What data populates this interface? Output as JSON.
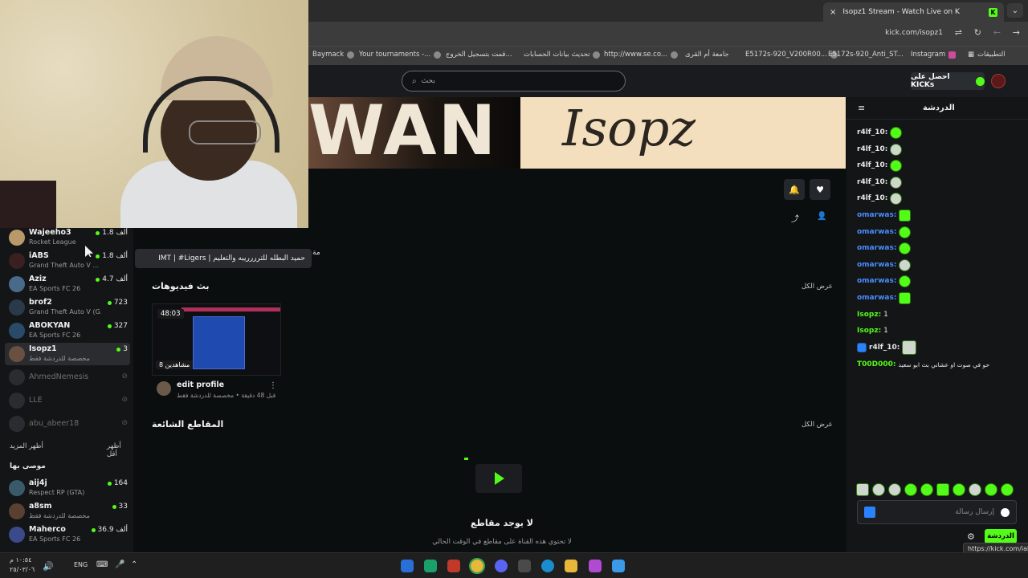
{
  "browser": {
    "tab_title": "Isopz1 Stream - Watch Live on K",
    "url": "kick.com/isopz1",
    "new_tab": "+",
    "close": "×",
    "bookmarks": [
      "Baymack",
      "Your tournaments -...",
      "قمت بتسجيل الخروج...",
      "تحديث بيانات الحسابات",
      "http://www.se.co...",
      "جامعة أم القرى",
      "E5172s-920_V200R00...",
      "E5172s-920_Anti_ST...",
      "Instagram",
      "التطبيقات"
    ]
  },
  "kick": {
    "search_placeholder": "بحث",
    "get_kicks": "احصل على KICKs"
  },
  "banner": {
    "left_text": "WAN",
    "right_text": "Isopz"
  },
  "sidebar": {
    "channels": [
      {
        "name": "Wajeeho3",
        "game": "Rocket League",
        "viewers": "1.8 ألف"
      },
      {
        "name": "iABS",
        "game": "Grand Theft Auto V ...",
        "viewers": "1.8 ألف"
      },
      {
        "name": "Aziz",
        "game": "EA Sports FC 26",
        "viewers": "4.7 ألف"
      },
      {
        "name": "brof2",
        "game": "Grand Theft Auto V (G...",
        "viewers": "723"
      },
      {
        "name": "ABOKYAN",
        "game": "EA Sports FC 26",
        "viewers": "327"
      },
      {
        "name": "Isopz1",
        "game": "مخصصة للدردشة فقط",
        "viewers": "3"
      }
    ],
    "offline": [
      "AhmedNemesis",
      "LLE",
      "abu_abeer18"
    ],
    "show_more": "أظهر المزيد",
    "show_less": "أظهر أقل",
    "recommended_title": "موصى بها",
    "recommended": [
      {
        "name": "aij4j",
        "game": "Respect RP (GTA)",
        "viewers": "164"
      },
      {
        "name": "a8sm",
        "game": "مخصصة للدردشة فقط",
        "viewers": "33"
      },
      {
        "name": "Maherco",
        "game": "EA Sports FC 26",
        "viewers": "36.9 ألف"
      }
    ]
  },
  "main": {
    "tooltip": "IMT | #Ligers | حميد البطله للترررريبه والتعليم",
    "past_videos_title": "بث فيديوهات",
    "show_all": "عرض الكل",
    "video": {
      "duration": "48:03",
      "views": "8 مشاهدين",
      "title": "edit profile",
      "sub": "قبل 48 دقيقة • مخصصة للدردشة فقط"
    },
    "clips_title": "المقاطع الشائعة",
    "clips_show_all": "عرض الكل",
    "empty_title": "لا يوجد مقاطع",
    "empty_sub": "لا تحتوي هذه القناة على مقاطع في الوقت الحالي",
    "cut_text": "مة"
  },
  "chat": {
    "title": "الدردشة",
    "messages": [
      {
        "user": "r4lf_10:",
        "color": "#e8e8e8",
        "text": ""
      },
      {
        "user": "r4lf_10:",
        "color": "#e8e8e8",
        "text": ""
      },
      {
        "user": "r4lf_10:",
        "color": "#e8e8e8",
        "text": ""
      },
      {
        "user": "r4lf_10:",
        "color": "#e8e8e8",
        "text": ""
      },
      {
        "user": "r4lf_10:",
        "color": "#e8e8e8",
        "text": ""
      },
      {
        "user": "omarwas:",
        "color": "#4a8cff",
        "text": ""
      },
      {
        "user": "omarwas:",
        "color": "#4a8cff",
        "text": ""
      },
      {
        "user": "omarwas:",
        "color": "#4a8cff",
        "text": ""
      },
      {
        "user": "omarwas:",
        "color": "#4a8cff",
        "text": ""
      },
      {
        "user": "omarwas:",
        "color": "#4a8cff",
        "text": ""
      },
      {
        "user": "omarwas:",
        "color": "#4a8cff",
        "text": ""
      },
      {
        "user": "Isopz:",
        "color": "#53fc18",
        "text": "1"
      },
      {
        "user": "Isopz:",
        "color": "#53fc18",
        "text": "1"
      },
      {
        "user": "r4lf_10:",
        "color": "#e8e8e8",
        "text": ""
      },
      {
        "user": "T00D000:",
        "color": "#53fc18",
        "text": "حو في صوت او عشاني بث ابو سعيد"
      }
    ],
    "input_placeholder": "إرسال رسالة",
    "send_label": "الدردشة",
    "status_url": "https://kick.com/iabs"
  },
  "taskbar": {
    "time": "١٠:٥٤ م",
    "date": "٢٥/٠٣/٠٦",
    "lang": "ENG"
  }
}
